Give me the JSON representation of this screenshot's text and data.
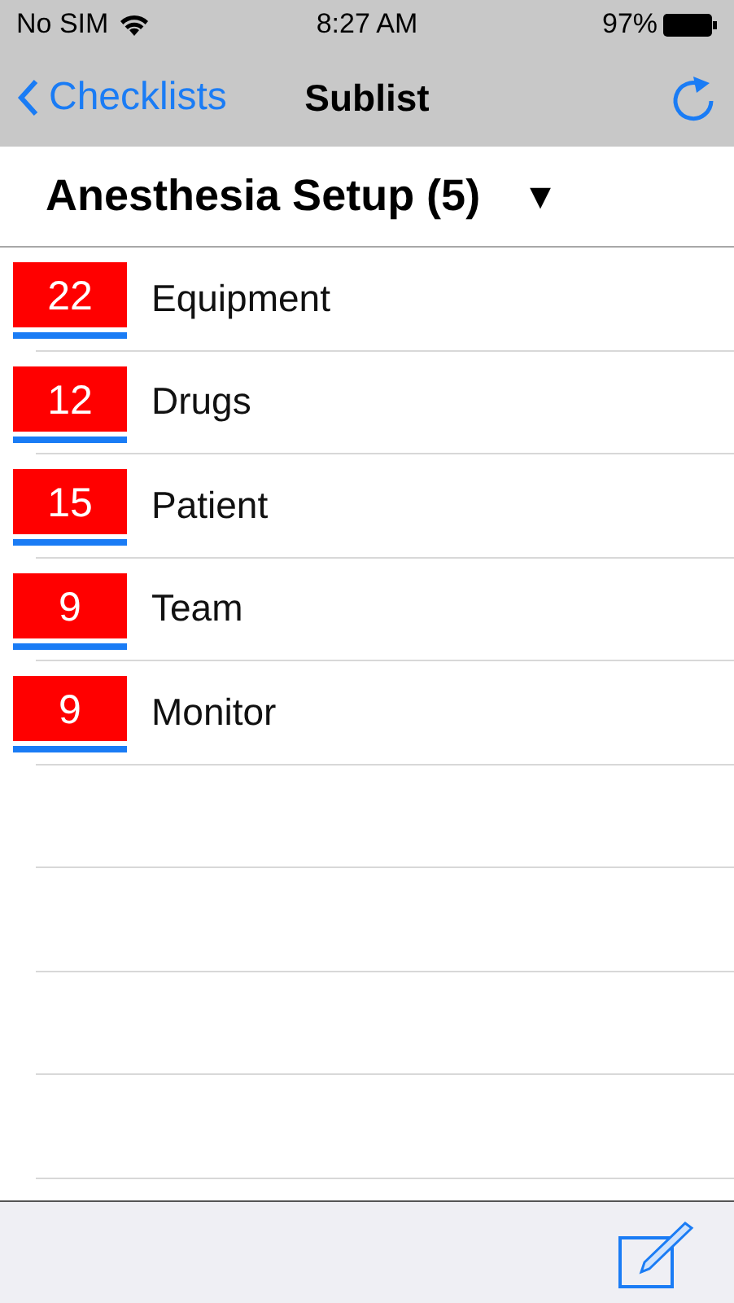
{
  "status_bar": {
    "carrier": "No SIM",
    "time": "8:27 AM",
    "battery": "97%"
  },
  "nav": {
    "back": "Checklists",
    "title": "Sublist"
  },
  "header": {
    "title": "Anesthesia Setup (5)",
    "caret": "▼"
  },
  "items": [
    {
      "count": "22",
      "label": "Equipment"
    },
    {
      "count": "12",
      "label": "Drugs"
    },
    {
      "count": "15",
      "label": "Patient"
    },
    {
      "count": "9",
      "label": "Team"
    },
    {
      "count": "9",
      "label": "Monitor"
    }
  ]
}
